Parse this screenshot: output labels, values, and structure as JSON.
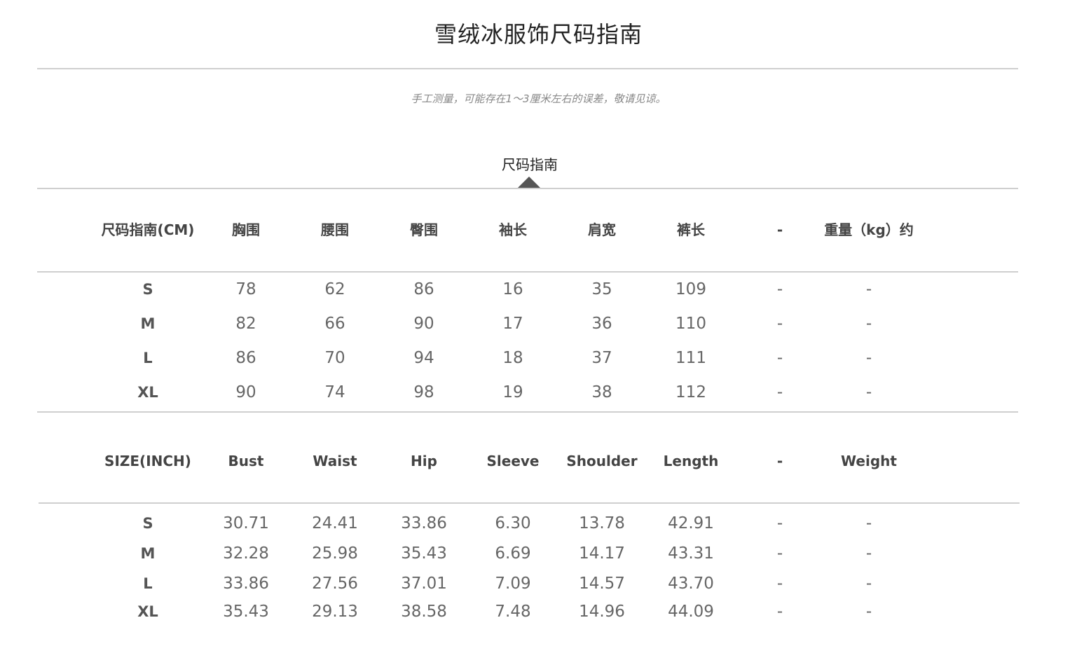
{
  "page": {
    "title": "雪绒冰服饰尺码指南",
    "note": "手工测量，可能存在1～3厘米左右的误差，敬请见谅。",
    "tab_label": "尺码指南"
  },
  "cm_table": {
    "headers": [
      "尺码指南(CM)",
      "胸围",
      "腰围",
      "臀围",
      "袖长",
      "肩宽",
      "裤长",
      "-",
      "重量（kg）约"
    ],
    "rows": [
      [
        "S",
        "78",
        "62",
        "86",
        "16",
        "35",
        "109",
        "-",
        "-"
      ],
      [
        "M",
        "82",
        "66",
        "90",
        "17",
        "36",
        "110",
        "-",
        "-"
      ],
      [
        "L",
        "86",
        "70",
        "94",
        "18",
        "37",
        "111",
        "-",
        "-"
      ],
      [
        "XL",
        "90",
        "74",
        "98",
        "19",
        "38",
        "112",
        "-",
        "-"
      ]
    ]
  },
  "inch_table": {
    "headers": [
      "SIZE(INCH)",
      "Bust",
      "Waist",
      "Hip",
      "Sleeve",
      "Shoulder",
      "Length",
      "-",
      "Weight"
    ],
    "rows": [
      [
        "S",
        "30.71",
        "24.41",
        "33.86",
        "6.30",
        "13.78",
        "42.91",
        "-",
        "-"
      ],
      [
        "M",
        "32.28",
        "25.98",
        "35.43",
        "6.69",
        "14.17",
        "43.31",
        "-",
        "-"
      ],
      [
        "L",
        "33.86",
        "27.56",
        "37.01",
        "7.09",
        "14.57",
        "43.70",
        "-",
        "-"
      ],
      [
        "XL",
        "35.43",
        "29.13",
        "38.58",
        "7.48",
        "14.96",
        "44.09",
        "-",
        "-"
      ]
    ]
  },
  "colors": {
    "divider": "#cfcfcf",
    "caret": "#555555",
    "note_text": "#888888"
  }
}
